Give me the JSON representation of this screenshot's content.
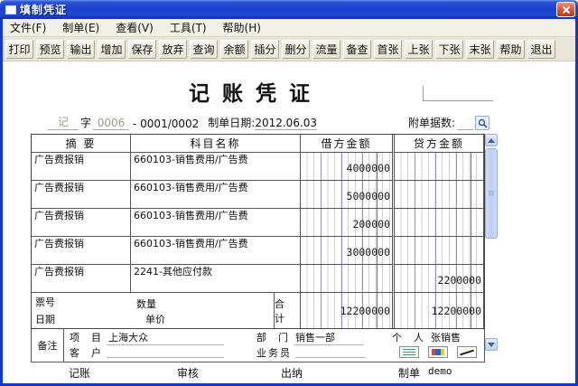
{
  "window": {
    "title": "填制凭证"
  },
  "menu": {
    "items": [
      "文件(F)",
      "制单(E)",
      "查看(V)",
      "工具(T)",
      "帮助(H)"
    ]
  },
  "toolbar": {
    "buttons": [
      "打印",
      "预览",
      "输出",
      "增加",
      "保存",
      "放弃",
      "查询",
      "余额",
      "插分",
      "删分",
      "流量",
      "备查",
      "首张",
      "上张",
      "下张",
      "末张",
      "帮助",
      "退出"
    ]
  },
  "voucher": {
    "title": "记账凭证",
    "word_type": "记",
    "word_label": "字",
    "word_no": "0006",
    "page_no": "-  0001/0002",
    "date_label": "制单日期:",
    "date": "2012.06.03",
    "attach_label": "附单据数:",
    "table": {
      "headers": {
        "summary": "摘  要",
        "account": "科目名称",
        "debit": "借方金额",
        "credit": "贷方金额"
      },
      "rows": [
        {
          "summary": "广告费报销",
          "account": "660103-销售费用/广告费",
          "debit": "4000000",
          "credit": ""
        },
        {
          "summary": "广告费报销",
          "account": "660103-销售费用/广告费",
          "debit": "5000000",
          "credit": ""
        },
        {
          "summary": "广告费报销",
          "account": "660103-销售费用/广告费",
          "debit": "200000",
          "credit": ""
        },
        {
          "summary": "广告费报销",
          "account": "660103-销售费用/广告费",
          "debit": "3000000",
          "credit": ""
        },
        {
          "summary": "广告费报销",
          "account": "2241-其他应付款",
          "debit": "",
          "credit": "2200000"
        }
      ],
      "footer": {
        "ticket_label": "票号",
        "date_label": "日期",
        "qty_label": "数量",
        "price_label": "单价",
        "total_label": "合 计",
        "debit_total": "12200000",
        "credit_total": "12200000"
      }
    },
    "remark": {
      "label": "备注",
      "project_label": "项  目",
      "project_value": "上海大众",
      "customer_label": "客  户",
      "customer_value": "",
      "dept_label": "部  门",
      "dept_value": "销售一部",
      "salesman_label": "业务员",
      "salesman_value": "",
      "person_label": "个  人",
      "person_value": "张销售"
    },
    "signs": {
      "book_label": "记账",
      "audit_label": "审核",
      "cashier_label": "出纳",
      "maker_label": "制单",
      "maker_name": "demo"
    }
  },
  "icons": {
    "window_icon": "white window glyph",
    "close_icon": "✕",
    "magnifier_icon": "magnifying glass",
    "scroll_up_icon": "▲",
    "scroll_down_icon": "▼",
    "note_icon": "lined note card",
    "stamp_icon": "color stamp card",
    "pen_icon": "signature pen card"
  },
  "colors": {
    "titlebar_blue": "#1c40cf",
    "frame_blue": "#1538c8",
    "close_red": "#c93a17",
    "toolbar_bg": "#e9e6d9",
    "ledger_gray_line": "#cfcfd8",
    "ledger_blue_line": "#9191cc",
    "ledger_red_line": "#bf5150",
    "scrollbar_blue": "#bccff5"
  }
}
